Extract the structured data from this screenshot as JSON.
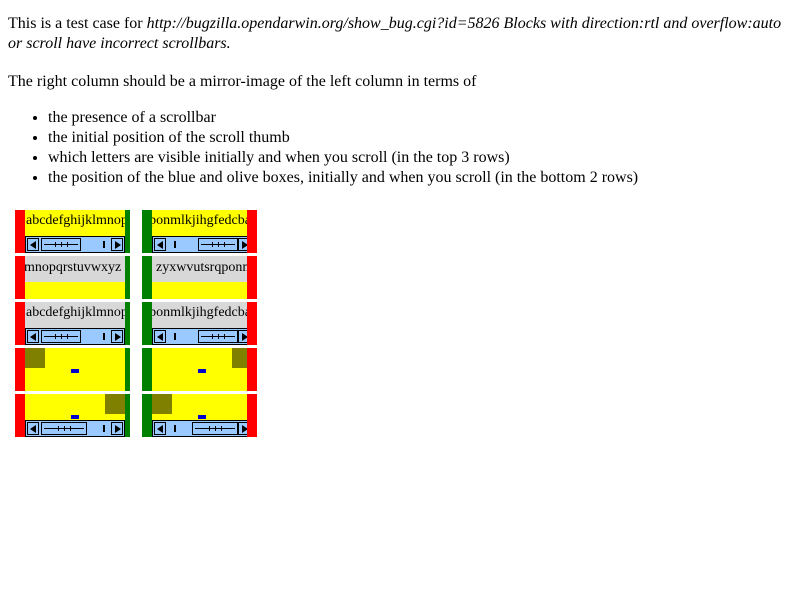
{
  "intro": {
    "prefix": "This is a test case for ",
    "link": "http://bugzilla.opendarwin.org/show_bug.cgi?id=5826",
    "description": " Blocks with direction:rtl and overflow:auto or scroll have incorrect scrollbars."
  },
  "instruction": "The right column should be a mirror-image of the left column in terms of",
  "bullets": [
    "the presence of a scrollbar",
    "the initial position of the scroll thumb",
    "which letters are visible initially and when you scroll (in the top 3 rows)",
    "the position of the blue and olive boxes, initially and when you scroll (in the bottom 2 rows)"
  ],
  "test_cells": {
    "row1_left_text": "abcdefghijklmnop",
    "row1_right_text": "ponmlkjihgfedcba",
    "row2_left_text": "mnopqrstuvwxyz",
    "row2_right_text": "zyxwvutsrqponm",
    "row3_left_text": "abcdefghijklmnop",
    "row3_right_text": "ponmlkjihgfedcba"
  },
  "colors": {
    "red_bar": "#ff0000",
    "green_bar": "#008000",
    "yellow_fill": "#ffff00",
    "gray_fill": "#d8d8d8",
    "olive_box": "#808000",
    "blue_box": "#0000cc",
    "scrollbar": "#99c9ff"
  }
}
